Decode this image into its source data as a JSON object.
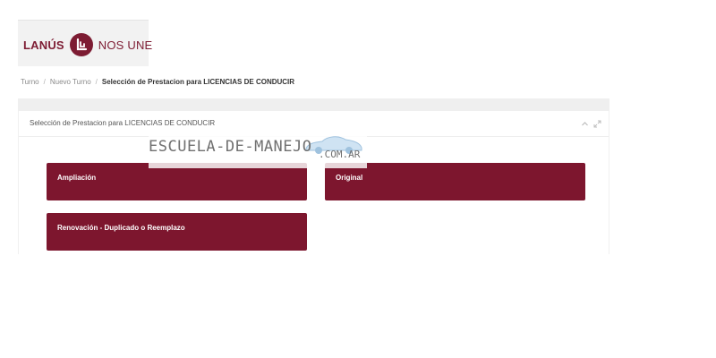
{
  "header": {
    "logo_left": "LANÚS",
    "logo_right": "NOS UNE",
    "brand_color": "#7d1c33"
  },
  "breadcrumb": {
    "items": [
      "Turno",
      "Nuevo Turno"
    ],
    "separator": "/",
    "current": "Selección de Prestacion para LICENCIAS DE CONDUCIR"
  },
  "panel": {
    "title": "Selección de Prestacion para LICENCIAS DE CONDUCIR",
    "collapse_icon": "chevron-up-icon",
    "expand_icon": "expand-icon"
  },
  "options": {
    "ampliacion": "Ampliación",
    "original": "Original",
    "renovacion": "Renovación - Duplicado o Reemplazo",
    "button_color": "#7d162e"
  },
  "watermark": {
    "text": "ESCUELA-DE-MANEJO",
    "suffix": ".COM.AR"
  }
}
